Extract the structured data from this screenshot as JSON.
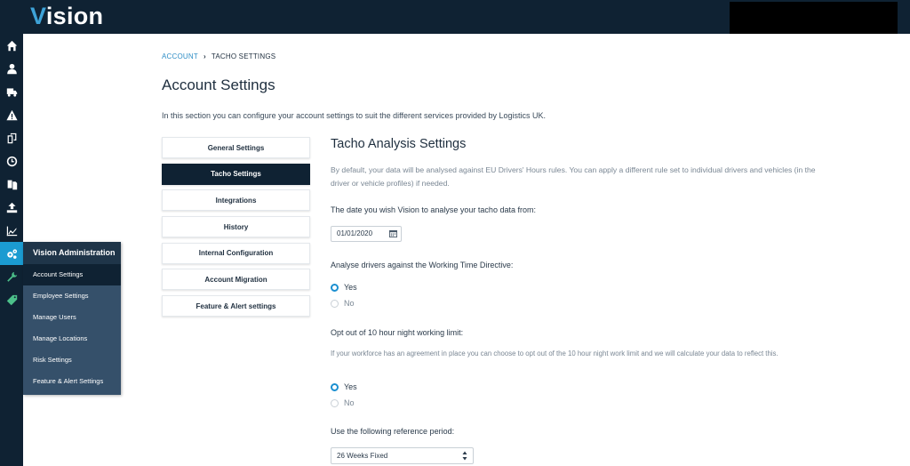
{
  "app": {
    "logo_v": "V",
    "logo_rest": "ision"
  },
  "rail": {
    "icons": [
      "home-icon",
      "user-icon",
      "truck-icon",
      "warning-icon",
      "documents-icon",
      "clock-icon",
      "files-icon",
      "upload-icon",
      "chart-icon",
      "gears-icon",
      "wrench-icon",
      "tag-icon"
    ]
  },
  "flyout": {
    "header": "Vision Administration",
    "items": [
      "Account Settings",
      "Employee Settings",
      "Manage Users",
      "Manage Locations",
      "Risk Settings",
      "Feature & Alert Settings"
    ]
  },
  "breadcrumb": {
    "root": "ACCOUNT",
    "current": "TACHO SETTINGS"
  },
  "page": {
    "title": "Account Settings",
    "intro": "In this section you can configure your account settings to suit the different services provided by Logistics UK."
  },
  "settings_nav": {
    "items": [
      "General Settings",
      "Tacho Settings",
      "Integrations",
      "History",
      "Internal Configuration",
      "Account Migration",
      "Feature & Alert settings"
    ],
    "active": "Tacho Settings"
  },
  "tacho": {
    "title": "Tacho Analysis Settings",
    "description": "By default, your data will be analysed against EU Drivers' Hours rules. You can apply a different rule set to individual drivers and vehicles (in the driver or vehicle profiles) if needed.",
    "date_label": "The date you wish Vision to analyse your tacho data from:",
    "date_value": "01/01/2020",
    "wtd_label": "Analyse drivers against the Working Time Directive:",
    "wtd_yes": "Yes",
    "wtd_no": "No",
    "wtd_selected": "Yes",
    "night_label": "Opt out of 10 hour night working limit:",
    "night_help": "If your workforce has an agreement in place you can choose to opt out of the 10 hour night work limit and we will calculate your data to reflect this.",
    "night_yes": "Yes",
    "night_no": "No",
    "night_selected": "Yes",
    "ref_label": "Use the following reference period:",
    "ref_value": "26 Weeks Fixed"
  },
  "colors": {
    "navy": "#0f2233",
    "accent": "#1b9bd1",
    "link": "#2f8ec6"
  }
}
